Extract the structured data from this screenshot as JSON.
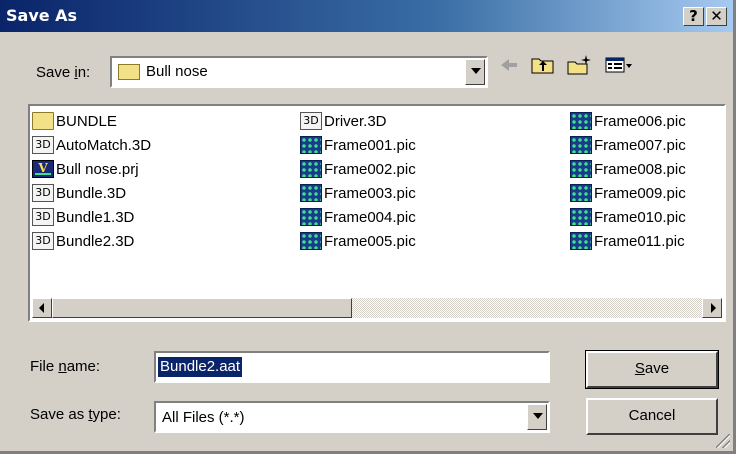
{
  "window": {
    "title": "Save As",
    "help_btn": "?",
    "close_btn": "✕"
  },
  "save_in": {
    "label_pre": "Save ",
    "label_u": "i",
    "label_post": "n:",
    "value": "Bull nose"
  },
  "files": [
    {
      "name": "BUNDLE",
      "icon": "folder-icon"
    },
    {
      "name": "AutoMatch.3D",
      "icon": "3d-file-icon"
    },
    {
      "name": "Bull nose.prj",
      "icon": "project-file-icon"
    },
    {
      "name": "Bundle.3D",
      "icon": "3d-file-icon"
    },
    {
      "name": "Bundle1.3D",
      "icon": "3d-file-icon"
    },
    {
      "name": "Bundle2.3D",
      "icon": "3d-file-icon"
    },
    {
      "name": "Driver.3D",
      "icon": "3d-file-icon"
    },
    {
      "name": "Frame001.pic",
      "icon": "pic-file-icon"
    },
    {
      "name": "Frame002.pic",
      "icon": "pic-file-icon"
    },
    {
      "name": "Frame003.pic",
      "icon": "pic-file-icon"
    },
    {
      "name": "Frame004.pic",
      "icon": "pic-file-icon"
    },
    {
      "name": "Frame005.pic",
      "icon": "pic-file-icon"
    },
    {
      "name": "Frame006.pic",
      "icon": "pic-file-icon"
    },
    {
      "name": "Frame007.pic",
      "icon": "pic-file-icon"
    },
    {
      "name": "Frame008.pic",
      "icon": "pic-file-icon"
    },
    {
      "name": "Frame009.pic",
      "icon": "pic-file-icon"
    },
    {
      "name": "Frame010.pic",
      "icon": "pic-file-icon"
    },
    {
      "name": "Frame011.pic",
      "icon": "pic-file-icon"
    }
  ],
  "icon_labels": {
    "threeD": "3D",
    "prj": "V"
  },
  "file_name": {
    "label_pre": "File ",
    "label_u": "n",
    "label_post": "ame:",
    "value": "Bundle2.aat"
  },
  "save_type": {
    "label_pre": "Save as ",
    "label_u": "t",
    "label_post": "ype:",
    "value": "All Files (*.*)"
  },
  "buttons": {
    "save_u": "S",
    "save_rest": "ave",
    "cancel": "Cancel"
  },
  "colors": {
    "title_start": "#0a246a",
    "title_end": "#a6caf0",
    "face": "#d4d0c8",
    "selection": "#0a246a"
  }
}
